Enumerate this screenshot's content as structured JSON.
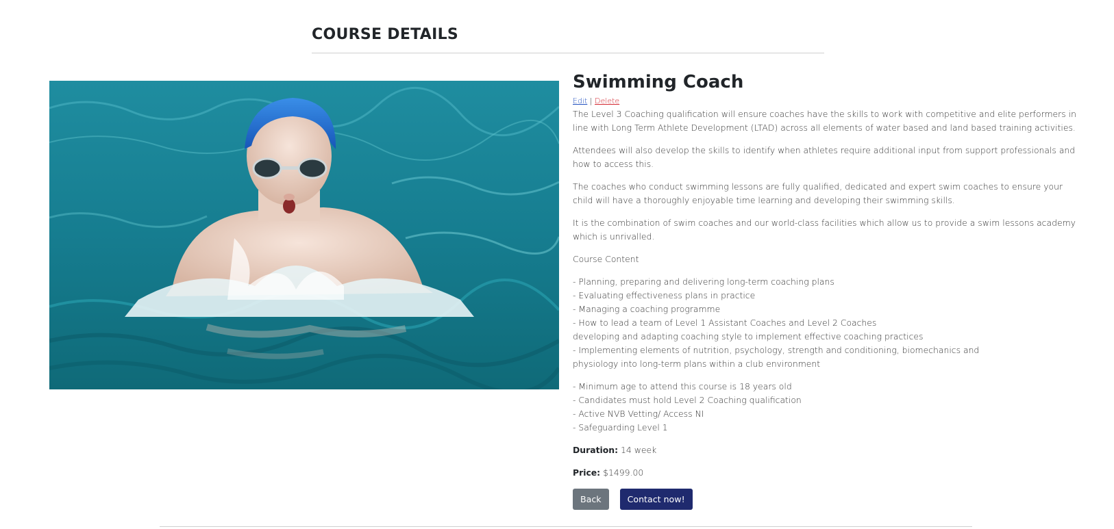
{
  "page": {
    "heading": "COURSE DETAILS"
  },
  "course": {
    "title": "Swimming Coach",
    "image_alt": "Swimmer in a blue cap and goggles doing breaststroke in a pool",
    "admin": {
      "edit_label": "Edit",
      "separator": "|",
      "delete_label": "Delete"
    },
    "paragraphs": [
      "The Level 3 Coaching qualification will ensure coaches have the skills to work with competitive and elite performers in line with Long Term Athlete Development (LTAD) across all elements of water based and land based training activities.",
      "Attendees will also develop the skills to identify when athletes require additional input from support professionals and how to access this.",
      "The coaches who conduct swimming lessons are fully qualified, dedicated and expert swim coaches to ensure your child will have a thoroughly enjoyable time learning and developing their swimming skills.",
      "It is the combination of swim coaches and our world-class facilities which allow us to provide a swim lessons academy which is unrivalled.",
      "Course Content"
    ],
    "content_items": [
      "- Planning, preparing and delivering long-term coaching plans",
      "- Evaluating effectiveness plans in practice",
      "- Managing a coaching programme",
      "- How to lead a team of Level 1 Assistant Coaches and Level 2 Coaches",
      "developing and adapting coaching style to implement effective coaching practices",
      "- Implementing elements of nutrition, psychology, strength and conditioning, biomechanics and",
      "physiology into long-term plans within a club environment"
    ],
    "requirements": [
      "- Minimum age to attend this course is 18 years old",
      "- Candidates must hold Level 2 Coaching qualification",
      "- Active NVB Vetting/ Access NI",
      "- Safeguarding Level 1"
    ],
    "duration": {
      "label": "Duration:",
      "value": "14 week"
    },
    "price": {
      "label": "Price:",
      "value": "$1499.00"
    }
  },
  "buttons": {
    "back_label": "Back",
    "contact_label": "Contact now!"
  },
  "colors": {
    "link_edit": "#1f4fbf",
    "link_delete": "#d3262f",
    "button_back": "#6c757d",
    "button_contact": "#1f2a6e",
    "pool_water": "#1d8ea0",
    "swim_cap": "#1e6fd0"
  }
}
